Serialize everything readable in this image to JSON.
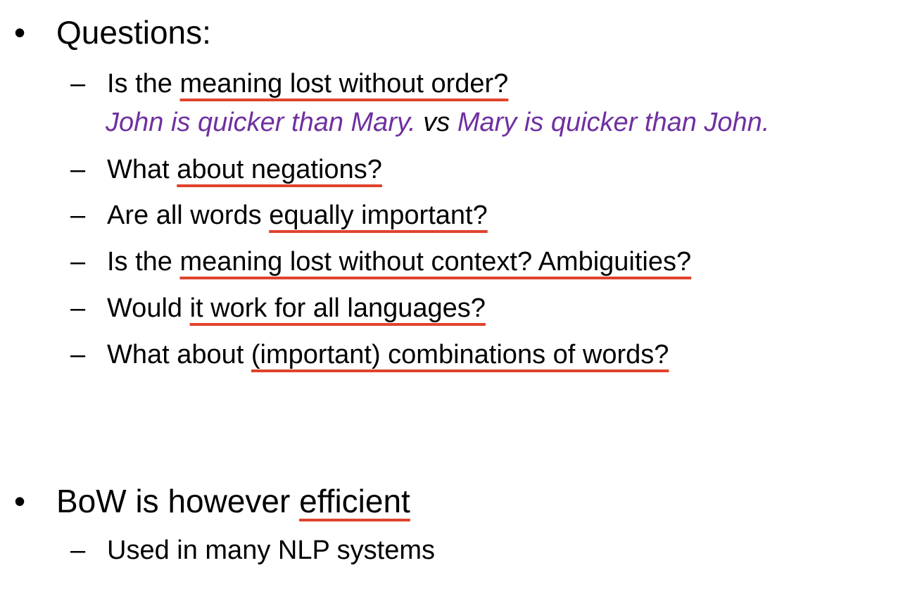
{
  "slide": {
    "questions": {
      "label": "Questions:",
      "items": [
        {
          "lead": "Is the ",
          "underlined": "meaning lost without order?"
        },
        {
          "lead": "What ",
          "underlined": "about negations?"
        },
        {
          "lead": "Are all words ",
          "underlined": "equally important?"
        },
        {
          "lead": "Is the ",
          "underlined": "meaning lost without context? Ambiguities?"
        },
        {
          "lead": "Would ",
          "underlined": "it work for all languages?"
        },
        {
          "lead": "What about ",
          "underlined": "(important) combinations of words?"
        }
      ],
      "example": {
        "sentence_a": "John is quicker than Mary.",
        "connector": "vs",
        "sentence_b": "Mary is quicker than John."
      }
    },
    "bow": {
      "lead": "BoW is however ",
      "underlined": "efficient",
      "items": [
        {
          "text": "Used in many NLP systems"
        }
      ]
    },
    "bullet_symbol": "•",
    "dash_symbol": "–",
    "colors": {
      "underline": "#e0432c",
      "example_text": "#7030a0",
      "text": "#000000",
      "background": "#ffffff"
    }
  }
}
